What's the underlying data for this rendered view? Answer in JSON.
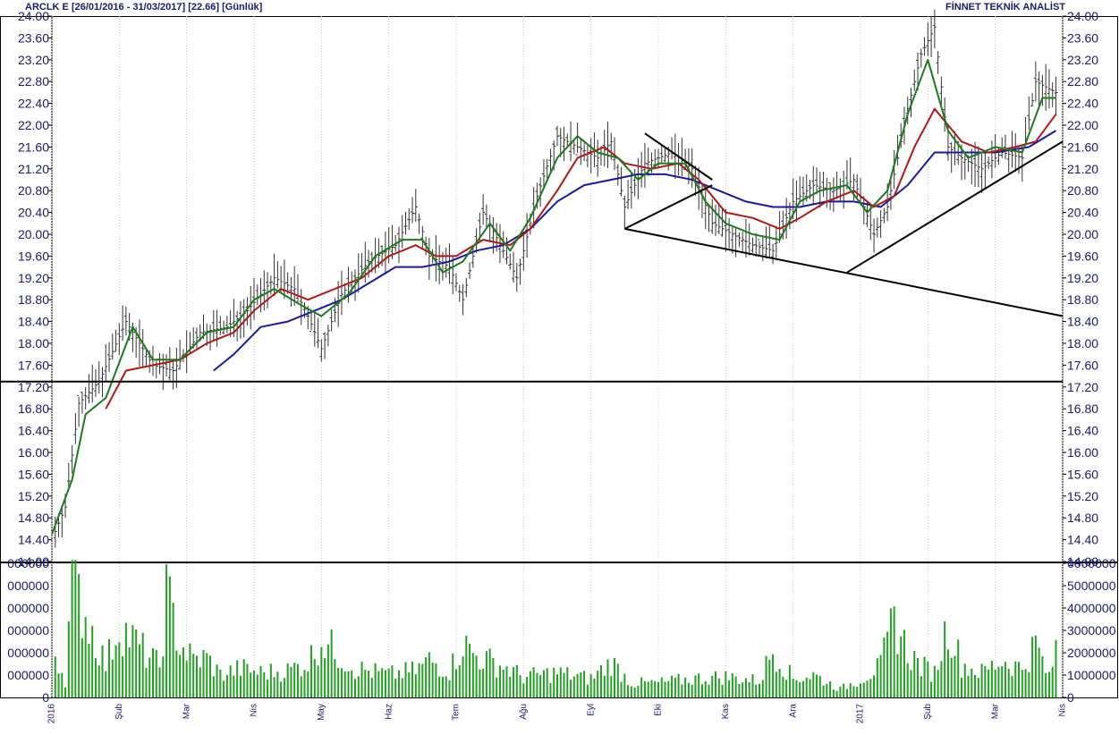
{
  "header": {
    "title_left": "ARCLK E  [26/01/2016 - 31/03/2017]  [22.66]  [Günlük]",
    "title_right": "FİNNET TEKNİK ANALİST"
  },
  "colors": {
    "price_bars": "#333333",
    "ma_short": "#1e7a1e",
    "ma_mid": "#b01818",
    "ma_long": "#1a1aa0",
    "volume": "#22a022",
    "axis_text": "#1a1a6e",
    "grid": "#c8c8c8"
  },
  "chart_data": [
    {
      "type": "candlestick-ohlc",
      "ylim": [
        14.0,
        24.0
      ],
      "yticks": [
        "24.00",
        "23.60",
        "23.20",
        "22.80",
        "22.40",
        "22.00",
        "21.60",
        "21.20",
        "20.80",
        "20.40",
        "20.00",
        "19.60",
        "19.20",
        "18.80",
        "18.40",
        "18.00",
        "17.60",
        "17.20",
        "16.80",
        "16.40",
        "16.00",
        "15.60",
        "15.20",
        "14.80",
        "14.40",
        "14.00"
      ],
      "x_labels": [
        "2016",
        "Şub",
        "Mar",
        "Nis",
        "May",
        "Haz",
        "Tem",
        "Ağu",
        "Eyl",
        "Eki",
        "Kas",
        "Ara",
        "2017",
        "Şub",
        "Mar",
        "Nis"
      ],
      "price_path": [
        [
          0,
          14.4
        ],
        [
          4,
          15.0
        ],
        [
          8,
          16.9
        ],
        [
          14,
          17.3
        ],
        [
          22,
          18.4
        ],
        [
          30,
          17.6
        ],
        [
          36,
          17.5
        ],
        [
          44,
          18.2
        ],
        [
          52,
          18.3
        ],
        [
          58,
          18.6
        ],
        [
          66,
          19.2
        ],
        [
          72,
          19.0
        ],
        [
          76,
          18.5
        ],
        [
          80,
          17.9
        ],
        [
          86,
          18.9
        ],
        [
          94,
          19.5
        ],
        [
          102,
          19.8
        ],
        [
          108,
          20.5
        ],
        [
          112,
          19.6
        ],
        [
          118,
          19.4
        ],
        [
          122,
          18.8
        ],
        [
          128,
          20.4
        ],
        [
          134,
          19.7
        ],
        [
          138,
          19.2
        ],
        [
          144,
          20.7
        ],
        [
          150,
          21.8
        ],
        [
          156,
          21.6
        ],
        [
          162,
          21.4
        ],
        [
          166,
          21.7
        ],
        [
          170,
          20.5
        ],
        [
          176,
          21.3
        ],
        [
          184,
          21.5
        ],
        [
          190,
          21.2
        ],
        [
          196,
          20.2
        ],
        [
          202,
          20.0
        ],
        [
          208,
          19.8
        ],
        [
          214,
          19.7
        ],
        [
          220,
          20.6
        ],
        [
          226,
          20.9
        ],
        [
          232,
          20.8
        ],
        [
          238,
          21.0
        ],
        [
          244,
          20.0
        ],
        [
          248,
          20.5
        ],
        [
          254,
          22.3
        ],
        [
          258,
          23.3
        ],
        [
          262,
          23.8
        ],
        [
          266,
          21.6
        ],
        [
          270,
          21.4
        ],
        [
          276,
          21.2
        ],
        [
          282,
          21.5
        ],
        [
          288,
          21.4
        ],
        [
          292,
          22.8
        ],
        [
          298,
          22.6
        ]
      ],
      "ma_short_path": [
        [
          0,
          14.5
        ],
        [
          6,
          15.5
        ],
        [
          10,
          16.7
        ],
        [
          16,
          17.0
        ],
        [
          24,
          18.3
        ],
        [
          30,
          17.7
        ],
        [
          38,
          17.7
        ],
        [
          46,
          18.2
        ],
        [
          54,
          18.3
        ],
        [
          60,
          18.8
        ],
        [
          66,
          19.0
        ],
        [
          74,
          18.7
        ],
        [
          80,
          18.5
        ],
        [
          88,
          18.9
        ],
        [
          96,
          19.6
        ],
        [
          104,
          19.9
        ],
        [
          110,
          19.9
        ],
        [
          116,
          19.3
        ],
        [
          122,
          19.5
        ],
        [
          130,
          20.2
        ],
        [
          136,
          19.7
        ],
        [
          142,
          20.3
        ],
        [
          150,
          21.4
        ],
        [
          156,
          21.8
        ],
        [
          162,
          21.5
        ],
        [
          168,
          21.4
        ],
        [
          174,
          21.0
        ],
        [
          180,
          21.3
        ],
        [
          188,
          21.3
        ],
        [
          194,
          20.6
        ],
        [
          200,
          20.2
        ],
        [
          208,
          20.0
        ],
        [
          216,
          19.9
        ],
        [
          222,
          20.6
        ],
        [
          228,
          20.8
        ],
        [
          236,
          20.9
        ],
        [
          242,
          20.4
        ],
        [
          248,
          20.8
        ],
        [
          254,
          22.2
        ],
        [
          260,
          23.2
        ],
        [
          266,
          21.9
        ],
        [
          272,
          21.4
        ],
        [
          280,
          21.6
        ],
        [
          288,
          21.5
        ],
        [
          294,
          22.5
        ],
        [
          298,
          22.5
        ]
      ],
      "ma_mid_path": [
        [
          16,
          16.8
        ],
        [
          22,
          17.5
        ],
        [
          30,
          17.6
        ],
        [
          38,
          17.7
        ],
        [
          46,
          18.0
        ],
        [
          54,
          18.2
        ],
        [
          60,
          18.6
        ],
        [
          68,
          19.0
        ],
        [
          76,
          18.8
        ],
        [
          84,
          19.0
        ],
        [
          92,
          19.2
        ],
        [
          100,
          19.6
        ],
        [
          108,
          19.8
        ],
        [
          114,
          19.6
        ],
        [
          120,
          19.6
        ],
        [
          128,
          19.9
        ],
        [
          136,
          19.8
        ],
        [
          142,
          20.1
        ],
        [
          150,
          20.8
        ],
        [
          156,
          21.4
        ],
        [
          164,
          21.6
        ],
        [
          170,
          21.3
        ],
        [
          178,
          21.2
        ],
        [
          186,
          21.3
        ],
        [
          192,
          21.0
        ],
        [
          200,
          20.4
        ],
        [
          208,
          20.3
        ],
        [
          216,
          20.1
        ],
        [
          222,
          20.3
        ],
        [
          230,
          20.6
        ],
        [
          238,
          20.8
        ],
        [
          244,
          20.5
        ],
        [
          250,
          20.7
        ],
        [
          256,
          21.6
        ],
        [
          262,
          22.3
        ],
        [
          270,
          21.7
        ],
        [
          278,
          21.5
        ],
        [
          286,
          21.6
        ],
        [
          292,
          21.7
        ],
        [
          298,
          22.2
        ]
      ],
      "ma_long_path": [
        [
          48,
          17.5
        ],
        [
          54,
          17.8
        ],
        [
          62,
          18.3
        ],
        [
          70,
          18.4
        ],
        [
          78,
          18.6
        ],
        [
          86,
          18.8
        ],
        [
          94,
          19.1
        ],
        [
          102,
          19.4
        ],
        [
          110,
          19.4
        ],
        [
          118,
          19.5
        ],
        [
          126,
          19.7
        ],
        [
          134,
          19.8
        ],
        [
          142,
          20.1
        ],
        [
          150,
          20.6
        ],
        [
          158,
          20.9
        ],
        [
          166,
          21.0
        ],
        [
          174,
          21.1
        ],
        [
          182,
          21.1
        ],
        [
          190,
          21.0
        ],
        [
          198,
          20.8
        ],
        [
          206,
          20.6
        ],
        [
          214,
          20.5
        ],
        [
          222,
          20.5
        ],
        [
          230,
          20.6
        ],
        [
          238,
          20.6
        ],
        [
          246,
          20.5
        ],
        [
          254,
          20.9
        ],
        [
          262,
          21.5
        ],
        [
          270,
          21.5
        ],
        [
          280,
          21.5
        ],
        [
          290,
          21.6
        ],
        [
          298,
          21.9
        ]
      ],
      "trend_lines": [
        {
          "from": [
            0,
            17.3
          ],
          "to": [
            300,
            17.3
          ]
        },
        {
          "from": [
            170,
            20.1
          ],
          "to": [
            300,
            18.5
          ]
        },
        {
          "from": [
            170,
            20.1
          ],
          "to": [
            196,
            20.9
          ]
        },
        {
          "from": [
            176,
            21.85
          ],
          "to": [
            196,
            21.0
          ]
        },
        {
          "from": [
            236,
            19.3
          ],
          "to": [
            300,
            21.7
          ]
        }
      ]
    },
    {
      "type": "bar",
      "series_name": "volume",
      "ylim": [
        0,
        6000000
      ],
      "yticks": [
        "6000000",
        "5000000",
        "4000000",
        "3000000",
        "2000000",
        "1000000",
        "0"
      ],
      "left_tick_labels": [
        "000000",
        "000000",
        "000000",
        "000000",
        "000000",
        "000000",
        "0"
      ],
      "volume_profile": [
        [
          0,
          2700000
        ],
        [
          4,
          800000
        ],
        [
          6,
          6100000
        ],
        [
          8,
          4800000
        ],
        [
          12,
          3200000
        ],
        [
          16,
          1600000
        ],
        [
          20,
          3500000
        ],
        [
          24,
          2800000
        ],
        [
          28,
          2100000
        ],
        [
          32,
          1500000
        ],
        [
          34,
          5000000
        ],
        [
          38,
          2600000
        ],
        [
          42,
          1800000
        ],
        [
          46,
          1900000
        ],
        [
          50,
          1100000
        ],
        [
          56,
          1400000
        ],
        [
          62,
          1200000
        ],
        [
          70,
          1300000
        ],
        [
          76,
          1700000
        ],
        [
          80,
          2800000
        ],
        [
          90,
          1400000
        ],
        [
          100,
          1100000
        ],
        [
          108,
          1300000
        ],
        [
          112,
          1800000
        ],
        [
          118,
          1300000
        ],
        [
          122,
          2600000
        ],
        [
          126,
          2000000
        ],
        [
          134,
          1500000
        ],
        [
          140,
          1000000
        ],
        [
          150,
          1200000
        ],
        [
          160,
          900000
        ],
        [
          166,
          1700000
        ],
        [
          172,
          700000
        ],
        [
          180,
          700000
        ],
        [
          190,
          900000
        ],
        [
          200,
          1000000
        ],
        [
          210,
          800000
        ],
        [
          214,
          2300000
        ],
        [
          220,
          900000
        ],
        [
          226,
          1100000
        ],
        [
          234,
          400000
        ],
        [
          240,
          900000
        ],
        [
          246,
          1500000
        ],
        [
          250,
          3800000
        ],
        [
          254,
          2200000
        ],
        [
          258,
          1500000
        ],
        [
          262,
          1200000
        ],
        [
          266,
          3600000
        ],
        [
          270,
          1600000
        ],
        [
          276,
          1200000
        ],
        [
          282,
          1800000
        ],
        [
          288,
          1400000
        ],
        [
          292,
          2600000
        ],
        [
          296,
          900000
        ],
        [
          298,
          2400000
        ]
      ]
    }
  ]
}
